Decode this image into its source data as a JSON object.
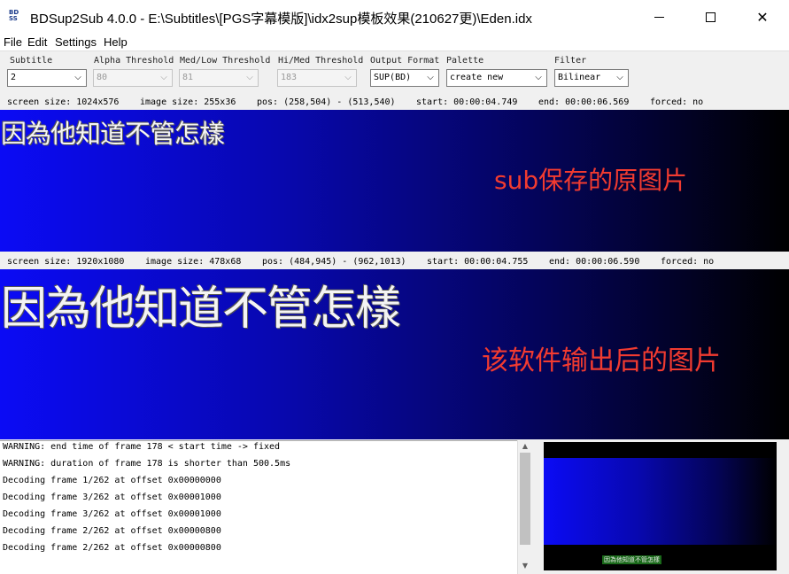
{
  "window": {
    "title": "BDSup2Sub 4.0.0 - E:\\Subtitles\\[PGS字幕模版]\\idx2sup模板效果(210627更)\\Eden.idx",
    "icon_text_top": "BD",
    "icon_text_bottom": "SS",
    "icon": "bdsup2sub-app-icon",
    "controls": {
      "minimize": "minimize-icon",
      "maximize": "maximize-icon",
      "close": "✕"
    }
  },
  "menu": [
    "File",
    "Edit",
    "Settings",
    "Help"
  ],
  "toolbar": {
    "subtitle": {
      "label": "Subtitle",
      "value": "2"
    },
    "alpha_threshold": {
      "label": "Alpha Threshold",
      "value": "80"
    },
    "med_low_threshold": {
      "label": "Med/Low Threshold",
      "value": "81"
    },
    "hi_med_threshold": {
      "label": "Hi/Med Threshold",
      "value": "183"
    },
    "output_format": {
      "label": "Output Format",
      "value": "SUP(BD)"
    },
    "palette": {
      "label": "Palette",
      "value": "create new"
    },
    "filter": {
      "label": "Filter",
      "value": "Bilinear"
    },
    "dropdown_arrow": "⌵"
  },
  "source_info": {
    "screen_size": "screen size: 1024x576",
    "image_size": "image size: 255x36",
    "pos": "pos: (258,504) - (513,540)",
    "start": "start: 00:00:04.749",
    "end": "end: 00:00:06.569",
    "forced": "forced: no"
  },
  "target_info": {
    "screen_size": "screen size: 1920x1080",
    "image_size": "image size: 478x68",
    "pos": "pos: (484,945) - (962,1013)",
    "start": "start: 00:00:04.755",
    "end": "end: 00:00:06.590",
    "forced": "forced: no"
  },
  "source_preview": {
    "subtitle_text": "因為他知道不管怎樣",
    "annotation": "sub保存的原图片"
  },
  "target_preview": {
    "subtitle_text": "因為他知道不管怎樣",
    "annotation": "该软件输出后的图片"
  },
  "log": [
    "WARNING: end time of frame 178 < start time -> fixed",
    "WARNING: duration of frame 178 is shorter than 500.5ms",
    "Decoding frame 1/262 at offset 0x00000000",
    "Decoding frame 3/262 at offset 0x00001000",
    "Decoding frame 3/262 at offset 0x00001000",
    "Decoding frame 2/262 at offset 0x00000800",
    "Decoding frame 2/262 at offset 0x00000800"
  ],
  "scroll": {
    "up": "▲",
    "down": "▼"
  },
  "thumbnail": {
    "subtitle_text": "因為他知道不管怎樣"
  },
  "colors": {
    "annotation_red": "#f23b30",
    "preview_blue": "#0b0bf5",
    "subtitle_white": "#f4f4f4"
  }
}
